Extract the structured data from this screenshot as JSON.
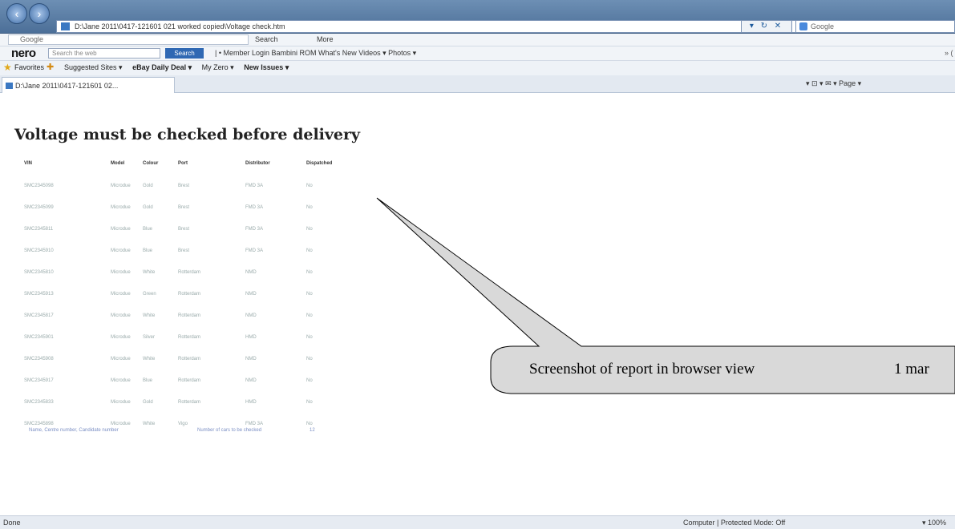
{
  "browser": {
    "window_title": "D:\\Jane 2011\\0417-121601 021 worked copied\\Voltage check.htm",
    "address": "D:\\Jane 2011\\0417-121601 021 worked copied\\Voltage check.htm",
    "address_tools": "▾ ↻ ✕",
    "search_placeholder": "Google",
    "google_bar": {
      "input": "Google",
      "search_label": "Search",
      "more_label": "More"
    },
    "nero_bar": {
      "logo": "nero",
      "input_placeholder": "Search the web",
      "search_button": "Search",
      "links": "| • Member Login  Bambini ROM  What's New  Videos ▾  Photos ▾",
      "right": "» ("
    },
    "favorites": {
      "label": "Favorites",
      "items": [
        "Suggested Sites ▾",
        "eBay Daily Deal ▾",
        "My Zero ▾",
        "New Issues ▾"
      ]
    },
    "tab_title": "D:\\Jane 2011\\0417-121601 02...",
    "command_bar": "▾ ⊡ ▾ ✉ ▾ Page ▾",
    "status_left": "Done",
    "status_zone": "Computer | Protected Mode: Off",
    "status_zoom": "▾ 100%"
  },
  "report": {
    "title": "Voltage must be checked before delivery",
    "headers": [
      "VIN",
      "Model",
      "Colour",
      "Port",
      "Distributor",
      "Dispatched"
    ],
    "rows": [
      [
        "SMC2345098",
        "Microdue",
        "Gold",
        "Brest",
        "FMD 3A",
        "No"
      ],
      [
        "SMC2345099",
        "Microdue",
        "Gold",
        "Brest",
        "FMD 3A",
        "No"
      ],
      [
        "SMC2345811",
        "Microdue",
        "Blue",
        "Brest",
        "FMD 3A",
        "No"
      ],
      [
        "SMC2345910",
        "Microdue",
        "Blue",
        "Brest",
        "FMD 3A",
        "No"
      ],
      [
        "SMC2345810",
        "Microdue",
        "White",
        "Rotterdam",
        "NMD",
        "No"
      ],
      [
        "SMC2345913",
        "Microdue",
        "Green",
        "Rotterdam",
        "NMD",
        "No"
      ],
      [
        "SMC2345817",
        "Microdue",
        "White",
        "Rotterdam",
        "NMD",
        "No"
      ],
      [
        "SMC2345901",
        "Microdue",
        "Silver",
        "Rotterdam",
        "HMD",
        "No"
      ],
      [
        "SMC2345908",
        "Microdue",
        "White",
        "Rotterdam",
        "NMD",
        "No"
      ],
      [
        "SMC2345917",
        "Microdue",
        "Blue",
        "Rotterdam",
        "NMD",
        "No"
      ],
      [
        "SMC2345833",
        "Microdue",
        "Gold",
        "Rotterdam",
        "HMD",
        "No"
      ],
      [
        "SMC2345898",
        "Microdue",
        "White",
        "Vigo",
        "FMD 3A",
        "No"
      ]
    ],
    "footer_left": "Name, Centre number, Candidate number",
    "footer_mid": "Number of cars to be checked",
    "footer_count": "12"
  },
  "callout": {
    "text": "Screenshot of report in browser view",
    "text_right": "1 mar"
  }
}
